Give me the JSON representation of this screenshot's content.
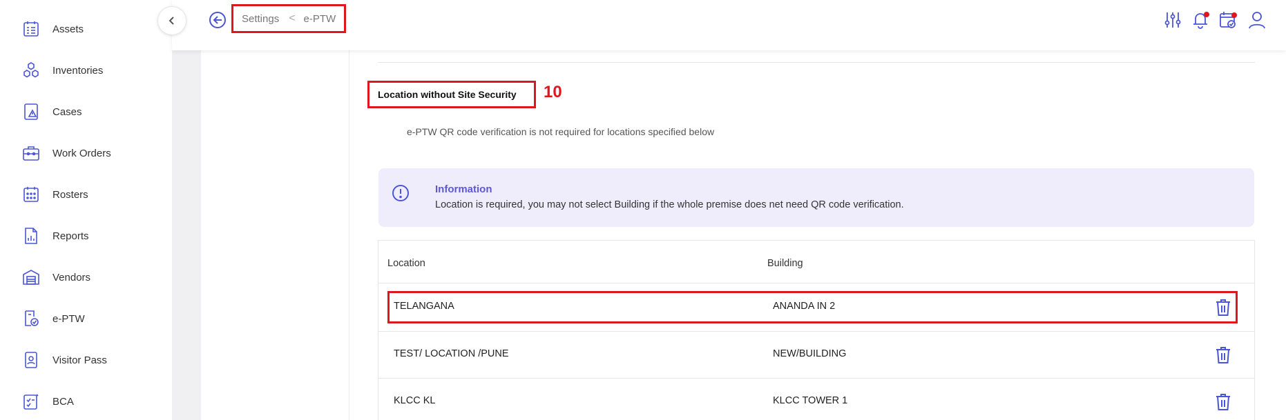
{
  "sidebar": {
    "items": [
      {
        "label": "Assets",
        "icon": "assets-icon"
      },
      {
        "label": "Inventories",
        "icon": "inventories-icon"
      },
      {
        "label": "Cases",
        "icon": "cases-icon"
      },
      {
        "label": "Work Orders",
        "icon": "work-orders-icon"
      },
      {
        "label": "Rosters",
        "icon": "rosters-icon"
      },
      {
        "label": "Reports",
        "icon": "reports-icon"
      },
      {
        "label": "Vendors",
        "icon": "vendors-icon"
      },
      {
        "label": "e-PTW",
        "icon": "eptw-icon"
      },
      {
        "label": "Visitor Pass",
        "icon": "visitor-pass-icon"
      },
      {
        "label": "BCA",
        "icon": "bca-icon"
      }
    ]
  },
  "breadcrumb": {
    "parent": "Settings",
    "separator": "<",
    "current": "e-PTW"
  },
  "section": {
    "title": "Location without Site Security",
    "annotation": "10",
    "description": "e-PTW QR code verification is not required for locations specified below"
  },
  "info": {
    "title": "Information",
    "text": "Location is required, you may not select Building if the whole premise does net need QR code verification."
  },
  "table": {
    "headers": {
      "location": "Location",
      "building": "Building"
    },
    "rows": [
      {
        "location": "TELANGANA",
        "building": "ANANDA IN 2"
      },
      {
        "location": "TEST/ LOCATION /PUNE",
        "building": "NEW/BUILDING"
      },
      {
        "location": "KLCC KL",
        "building": "KLCC TOWER 1"
      }
    ]
  },
  "colors": {
    "accent": "#4a55d6",
    "annotation_red": "#e0161f",
    "info_bg": "#efedfb"
  }
}
